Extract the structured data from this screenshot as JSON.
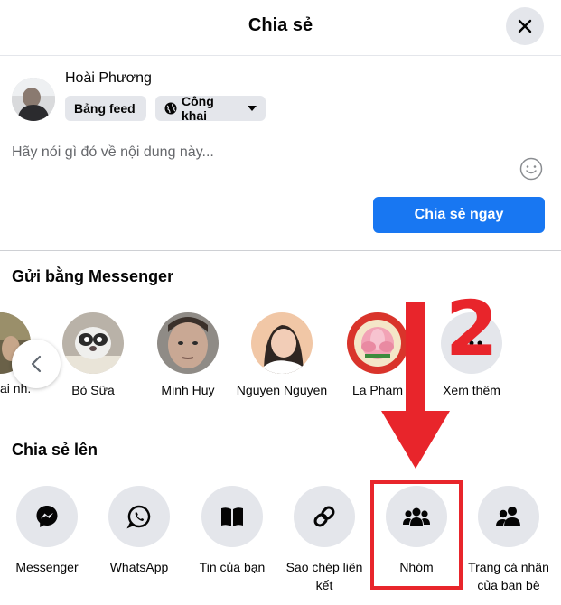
{
  "dialog": {
    "title": "Chia sẻ",
    "close_icon": "close-icon"
  },
  "composer": {
    "user_name": "Hoài Phương",
    "audience_feed": "Bảng feed",
    "audience_privacy": "Công khai",
    "placeholder": "Hãy nói gì đó về nội dung này...",
    "share_now_label": "Chia sẻ ngay"
  },
  "messenger": {
    "title": "Gửi bằng Messenger",
    "partial_contact": "ai nh...",
    "contacts": [
      {
        "name": "Bò Sữa"
      },
      {
        "name": "Minh Huy"
      },
      {
        "name": "Nguyen Nguyen"
      },
      {
        "name": "La Pham"
      },
      {
        "name": "Xem thêm"
      }
    ]
  },
  "share_to": {
    "title": "Chia sẻ lên",
    "items": [
      {
        "label": "Messenger",
        "icon": "messenger-icon"
      },
      {
        "label": "WhatsApp",
        "icon": "whatsapp-icon"
      },
      {
        "label": "Tin của bạn",
        "icon": "story-book-icon"
      },
      {
        "label": "Sao chép liên kết",
        "icon": "link-icon"
      },
      {
        "label": "Nhóm",
        "icon": "group-icon"
      },
      {
        "label": "Trang cá nhân của bạn bè",
        "icon": "friends-icon"
      }
    ]
  },
  "annotation": {
    "step_number": "2",
    "color": "#e8252b"
  },
  "colors": {
    "primary": "#1877f2",
    "chip_bg": "#e4e6eb",
    "secondary_text": "#65676b"
  }
}
